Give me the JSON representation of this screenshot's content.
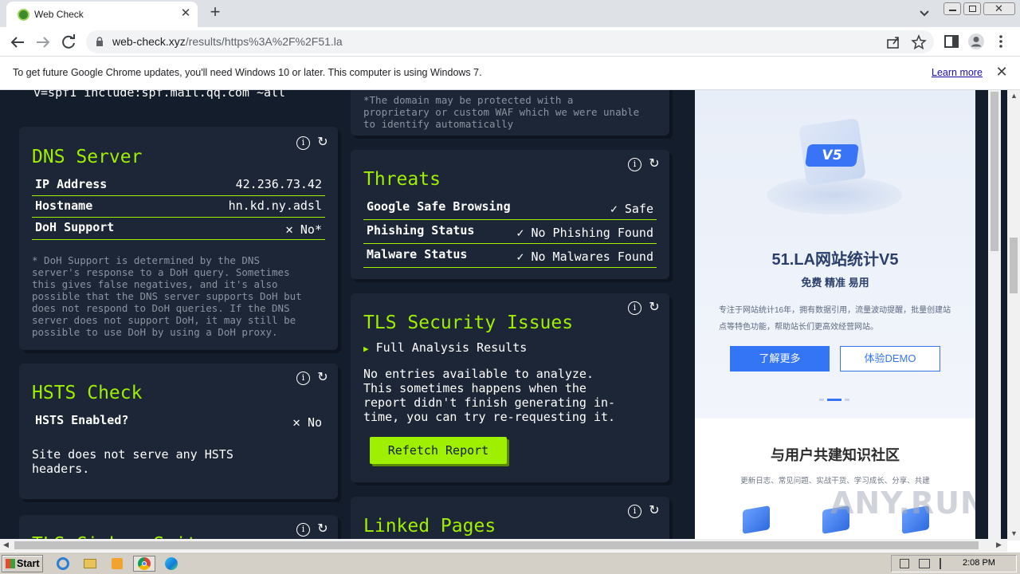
{
  "browser": {
    "tab_title": "Web Check",
    "url_host": "web-check.xyz",
    "url_path": "/results/https%3A%2F%2F51.la"
  },
  "infobar": {
    "message": "To get future Google Chrome updates, you'll need Windows 10 or later. This computer is using Windows 7.",
    "link": "Learn more"
  },
  "cards": {
    "spf_fragment": "v=spf1 include:spf.mail.qq.com ~all",
    "waf_note": "*The domain may be protected with a\nproprietary or custom WAF which we were unable\nto identify automatically",
    "dns": {
      "title": "DNS Server",
      "rows": [
        {
          "label": "IP Address",
          "value": "42.236.73.42"
        },
        {
          "label": "Hostname",
          "value": "hn.kd.ny.adsl"
        },
        {
          "label": "DoH Support",
          "value": "No*"
        }
      ],
      "note": "* DoH Support is determined by the DNS\nserver's response to a DoH query. Sometimes\nthis gives false negatives, and it's also\npossible that the DNS server supports DoH but\ndoes not respond to DoH queries. If the DNS\nserver does not support DoH, it may still be\npossible to use DoH by using a DoH proxy."
    },
    "hsts": {
      "title": "HSTS Check",
      "row_label": "HSTS Enabled?",
      "row_value": "No",
      "body": "Site does not serve any HSTS\nheaders."
    },
    "tls_cipher_partial": "TLS Cipher Suites",
    "threats": {
      "title": "Threats",
      "rows": [
        {
          "label": "Google Safe Browsing",
          "value": "Safe"
        },
        {
          "label": "Phishing Status",
          "value": "No Phishing Found"
        },
        {
          "label": "Malware Status",
          "value": "No Malwares Found"
        }
      ]
    },
    "tls_issues": {
      "title": "TLS Security Issues",
      "summary": "Full Analysis Results",
      "body": "No entries available to analyze.\nThis sometimes happens when the\nreport didn't finish generating in-\ntime, you can try re-requesting it.",
      "button": "Refetch Report"
    },
    "linked_pages": {
      "title": "Linked Pages"
    }
  },
  "ad": {
    "badge": "V5",
    "title": "51.LA网站统计V5",
    "subtitle": "免费 精准 易用",
    "desc": "专注于网站统计16年，拥有数据引用，流量波动提醒，批量创建站点等特色功能，帮助站长们更高效经营网站。",
    "btn_primary": "了解更多",
    "btn_secondary": "体验DEMO",
    "section_title": "与用户共建知识社区",
    "section_sub": "更新日志、常见问题、实战干货、学习成长、分享、共建",
    "watermark": "ANY.RUN"
  },
  "taskbar": {
    "start": "Start",
    "time": "2:08 PM"
  },
  "colors": {
    "accent": "#9fef00",
    "page_bg": "#141d2b",
    "card_bg": "#1d2637"
  }
}
